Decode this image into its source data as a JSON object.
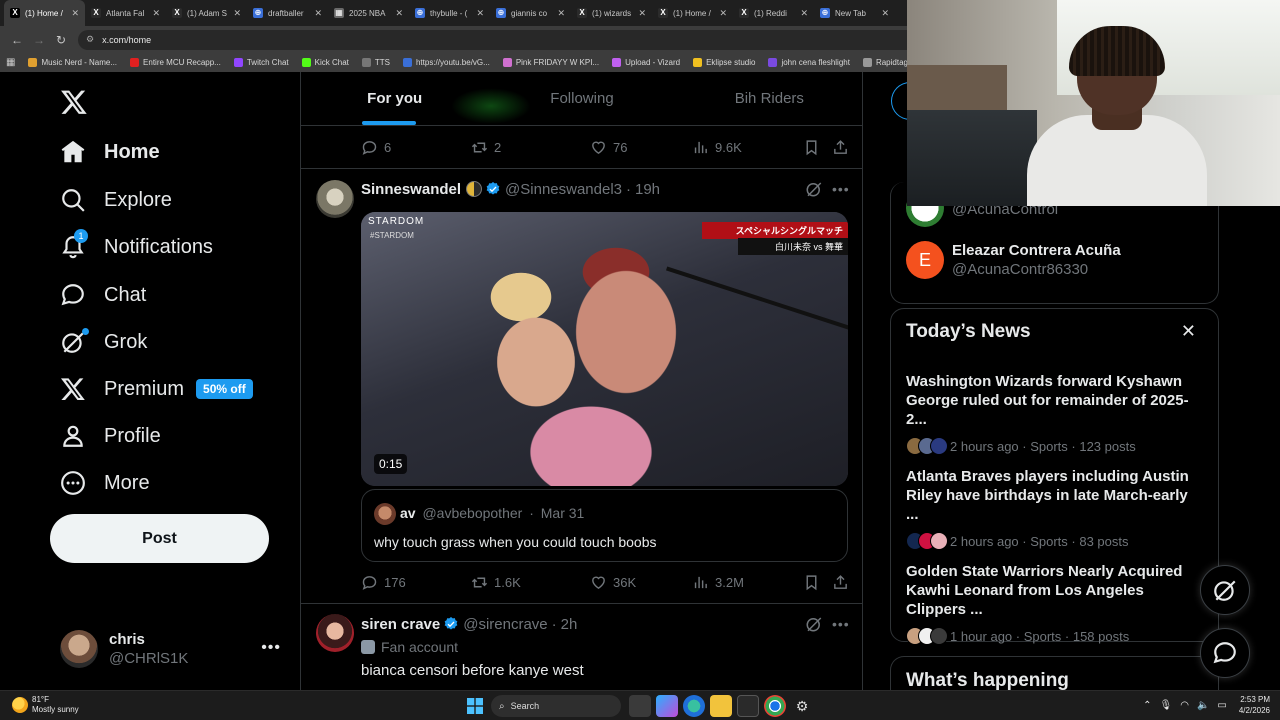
{
  "browser": {
    "tabs": [
      {
        "label": "(1) Home /",
        "active": true,
        "color": "#000000",
        "glyph": "X"
      },
      {
        "label": "Atlanta Fal",
        "active": false,
        "color": "#2b2b2b",
        "glyph": "X"
      },
      {
        "label": "(1) Adam S",
        "active": false,
        "color": "#2b2b2b",
        "glyph": "X"
      },
      {
        "label": "draftballer",
        "active": false,
        "color": "#3a6fd8",
        "glyph": "⊕"
      },
      {
        "label": "2025 NBA",
        "active": false,
        "color": "#6a6a6a",
        "glyph": "▦"
      },
      {
        "label": "thybulle - (",
        "active": false,
        "color": "#3a6fd8",
        "glyph": "⊕"
      },
      {
        "label": "giannis co",
        "active": false,
        "color": "#3a6fd8",
        "glyph": "⊕"
      },
      {
        "label": "(1) wizards",
        "active": false,
        "color": "#2b2b2b",
        "glyph": "X"
      },
      {
        "label": "(1) Home /",
        "active": false,
        "color": "#2b2b2b",
        "glyph": "X"
      },
      {
        "label": "(1) Reddi",
        "active": false,
        "color": "#2b2b2b",
        "glyph": "X"
      },
      {
        "label": "New Tab",
        "active": false,
        "color": "#3a6fd8",
        "glyph": "⊕"
      }
    ],
    "url": "x.com/home",
    "bookmarks": [
      {
        "label": "Music Nerd - Name...",
        "color": "#e0a030"
      },
      {
        "label": "Entire MCU Recapp...",
        "color": "#e02020"
      },
      {
        "label": "Twitch Chat",
        "color": "#9146ff"
      },
      {
        "label": "Kick Chat",
        "color": "#53fc18"
      },
      {
        "label": "TTS",
        "color": "#777777"
      },
      {
        "label": "https://youtu.be/vG...",
        "color": "#3a6fd8"
      },
      {
        "label": "Pink FRIDAYY W KPI...",
        "color": "#d070d0"
      },
      {
        "label": "Upload - Vizard",
        "color": "#c060f0"
      },
      {
        "label": "Eklipse studio",
        "color": "#f0c020"
      },
      {
        "label": "john cena fleshlight",
        "color": "#7a4ae0"
      },
      {
        "label": "Rapidtags | YouTub...",
        "color": "#999999"
      }
    ]
  },
  "sidebar": {
    "nav": [
      {
        "key": "home",
        "label": "Home",
        "active": true
      },
      {
        "key": "explore",
        "label": "Explore",
        "active": false
      },
      {
        "key": "notifications",
        "label": "Notifications",
        "active": false,
        "badge": "1"
      },
      {
        "key": "chat",
        "label": "Chat",
        "active": false
      },
      {
        "key": "grok",
        "label": "Grok",
        "active": false
      },
      {
        "key": "premium",
        "label": "Premium",
        "active": false,
        "pill": "50% off"
      },
      {
        "key": "profile",
        "label": "Profile",
        "active": false
      },
      {
        "key": "more",
        "label": "More",
        "active": false
      }
    ],
    "post_label": "Post",
    "account": {
      "name": "chris",
      "handle": "@CHRlS1K"
    }
  },
  "feed": {
    "tabs": [
      {
        "label": "For you",
        "active": true
      },
      {
        "label": "Following",
        "active": false
      },
      {
        "label": "Bih Riders",
        "active": false
      }
    ],
    "prev_tweet_actions": {
      "replies": "6",
      "reposts": "2",
      "likes": "76",
      "views": "9.6K"
    },
    "tweet1": {
      "name": "Sinneswandel",
      "handle": "@Sinneswandel3",
      "time": "19h",
      "video": {
        "duration": "0:15",
        "watermark": "STARDOM",
        "watermark_sub": "#STARDOM",
        "banner_top": "スペシャルシングルマッチ",
        "banner_bottom": "白川未奈 vs 舞華"
      },
      "quote": {
        "name": "av",
        "handle": "@avbebopother",
        "time": "Mar 31",
        "text": "why touch grass when you could touch boobs"
      },
      "actions": {
        "replies": "176",
        "reposts": "1.6K",
        "likes": "36K",
        "views": "3.2M"
      }
    },
    "tweet2": {
      "name": "siren crave",
      "handle": "@sirencrave",
      "time": "2h",
      "label": "Fan account",
      "text": "bianca censori before kanye west"
    }
  },
  "right": {
    "follows": [
      {
        "name": "",
        "handle": "@AcunaControl",
        "avatar_color": "#ffffff",
        "initial": ""
      },
      {
        "name": "Eleazar Contrera Acuña",
        "handle": "@AcunaContr86330",
        "avatar_color": "#f4511e",
        "initial": "E"
      }
    ],
    "news_title": "Today’s News",
    "news": [
      {
        "headline": "Washington Wizards forward Kyshawn George ruled out for remainder of 2025-2...",
        "meta": "2 hours ago · Sports · 123 posts",
        "colors": [
          "#8a6a40",
          "#5a6a90",
          "#2a3a80"
        ]
      },
      {
        "headline": "Atlanta Braves players including Austin Riley have birthdays in late March-early ...",
        "meta": "2 hours ago · Sports · 83 posts",
        "colors": [
          "#13274f",
          "#ce1141",
          "#e8b0b8"
        ]
      },
      {
        "headline": "Golden State Warriors Nearly Acquired Kawhi Leonard from Los Angeles Clippers ...",
        "meta": "1 hour ago · Sports · 158 posts",
        "colors": [
          "#c8a080",
          "#f0f0f0",
          "#3a3a3a"
        ]
      }
    ],
    "whats_happening": "What’s happening"
  },
  "taskbar": {
    "temp": "81°F",
    "weather": "Mostly sunny",
    "search_label": "Search",
    "time": "2:53 PM",
    "date": "4/2/2026"
  },
  "colors": {
    "accent": "#1d9bf0",
    "background": "#000000",
    "muted": "#71767b",
    "border": "#2f3336"
  }
}
